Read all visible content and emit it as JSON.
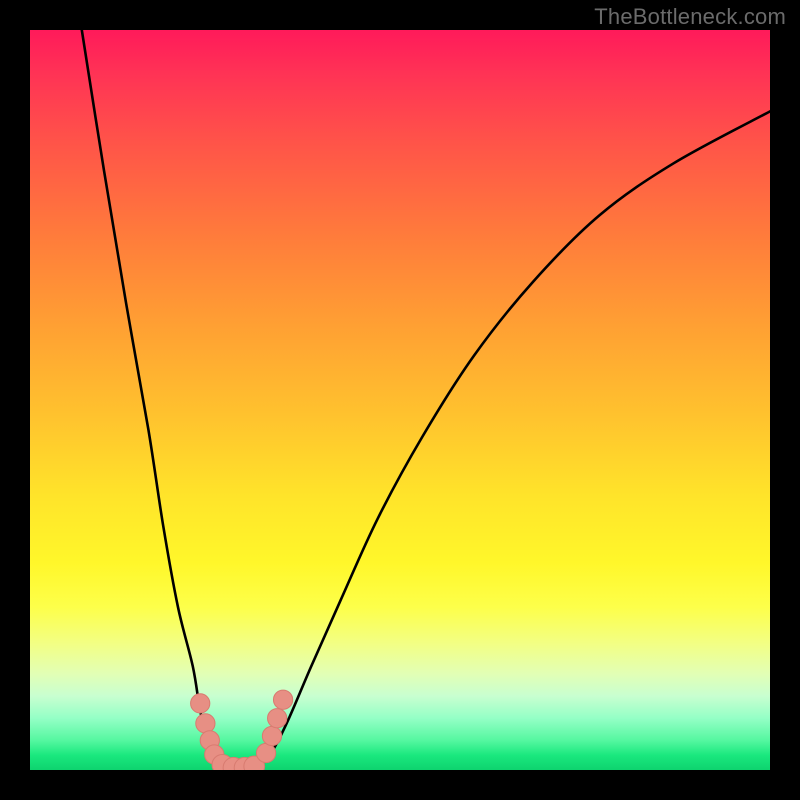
{
  "watermark": "TheBottleneck.com",
  "colors": {
    "frame": "#000000",
    "curve_stroke": "#000000",
    "marker_fill": "#e78f84",
    "marker_stroke": "#d87b70",
    "gradient_stops": [
      "#ff1a5a",
      "#ff3355",
      "#ff5349",
      "#ff7c3b",
      "#ffa033",
      "#ffc22e",
      "#ffe42a",
      "#fff72a",
      "#fdff4a",
      "#f2ff85",
      "#e2ffb5",
      "#c8ffd0",
      "#94ffc6",
      "#55f7a0",
      "#1ae87e",
      "#0ed36f"
    ]
  },
  "chart_data": {
    "type": "line",
    "title": "",
    "xlabel": "",
    "ylabel": "",
    "ylim": [
      0,
      100
    ],
    "xlim": [
      0,
      100
    ],
    "note": "Two curves extend from the top edge down into a valley near the bottom-center-left, then the right curve rises back toward the upper-right. Coordinates below are in percent of the plot area (0–100 on each axis). y=0 is the bottom, y=100 is the top.",
    "series": [
      {
        "name": "left-arm",
        "x": [
          7,
          10,
          13,
          16,
          18,
          20,
          22,
          23,
          24,
          25,
          26
        ],
        "y": [
          100,
          81,
          63,
          46,
          33,
          22,
          14,
          8,
          4,
          1.5,
          0.5
        ]
      },
      {
        "name": "right-arm",
        "x": [
          31,
          33,
          35,
          38,
          42,
          47,
          53,
          60,
          68,
          77,
          87,
          100
        ],
        "y": [
          0.5,
          3,
          7,
          14,
          23,
          34,
          45,
          56,
          66,
          75,
          82,
          89
        ]
      },
      {
        "name": "valley-floor",
        "x": [
          26,
          27.5,
          29,
          30.5,
          31
        ],
        "y": [
          0.5,
          0.2,
          0.2,
          0.3,
          0.5
        ]
      }
    ],
    "markers": [
      {
        "x": 23.0,
        "y": 9.0,
        "r": 1.3
      },
      {
        "x": 23.7,
        "y": 6.3,
        "r": 1.3
      },
      {
        "x": 24.3,
        "y": 4.0,
        "r": 1.3
      },
      {
        "x": 24.9,
        "y": 2.1,
        "r": 1.3
      },
      {
        "x": 26.0,
        "y": 0.7,
        "r": 1.4
      },
      {
        "x": 27.5,
        "y": 0.3,
        "r": 1.4
      },
      {
        "x": 29.0,
        "y": 0.3,
        "r": 1.4
      },
      {
        "x": 30.3,
        "y": 0.5,
        "r": 1.4
      },
      {
        "x": 31.9,
        "y": 2.3,
        "r": 1.3
      },
      {
        "x": 32.7,
        "y": 4.6,
        "r": 1.3
      },
      {
        "x": 33.4,
        "y": 7.0,
        "r": 1.3
      },
      {
        "x": 34.2,
        "y": 9.5,
        "r": 1.3
      }
    ]
  }
}
